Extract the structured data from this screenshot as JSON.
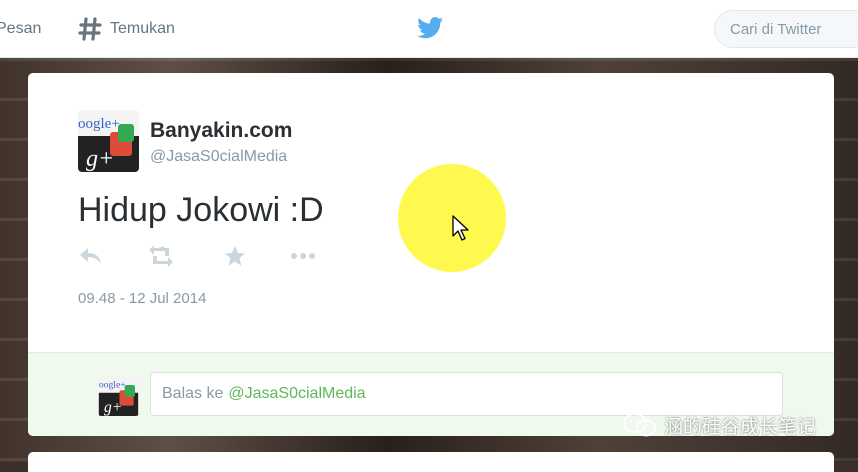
{
  "topbar": {
    "messages_label": "Pesan",
    "discover_label": "Temukan",
    "search_placeholder": "Cari di Twitter"
  },
  "tweet": {
    "display_name": "Banyakin.com",
    "screen_name": "@JasaS0cialMedia",
    "text": "Hidup Jokowi :D",
    "timestamp": "09.48 - 12 Jul 2014",
    "avatar_text": {
      "top": "oogle+",
      "bottom": "g+"
    }
  },
  "reply": {
    "prefix": "Balas ke",
    "handle": "@JasaS0cialMedia"
  },
  "watermark": {
    "text": "涵的硅谷成长笔记"
  },
  "colors": {
    "twitter_blue": "#55acee",
    "reply_green": "#5fb85a",
    "gplus_red": "#dd4b39"
  },
  "icons": [
    "hashtag-icon",
    "twitter-bird-icon",
    "reply-icon",
    "retweet-icon",
    "favorite-icon",
    "more-icon",
    "cursor-icon"
  ]
}
